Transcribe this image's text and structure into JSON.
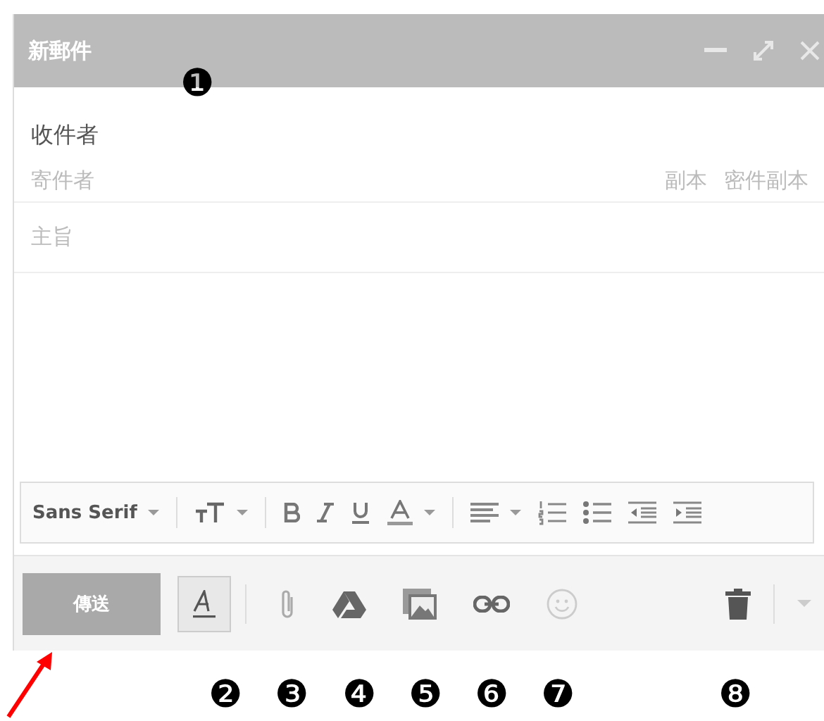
{
  "window": {
    "title": "新郵件",
    "callout": "❶"
  },
  "recipients": {
    "to": "收件者",
    "from": "寄件者",
    "cc": "副本",
    "bcc": "密件副本"
  },
  "subject": {
    "placeholder": "主旨"
  },
  "format_toolbar": {
    "font": "Sans Serif"
  },
  "send_button": {
    "label": "傳送",
    "disabled": true
  },
  "callouts": [
    "❷",
    "❸",
    "❹",
    "❺",
    "❻",
    "❼",
    "❽"
  ]
}
